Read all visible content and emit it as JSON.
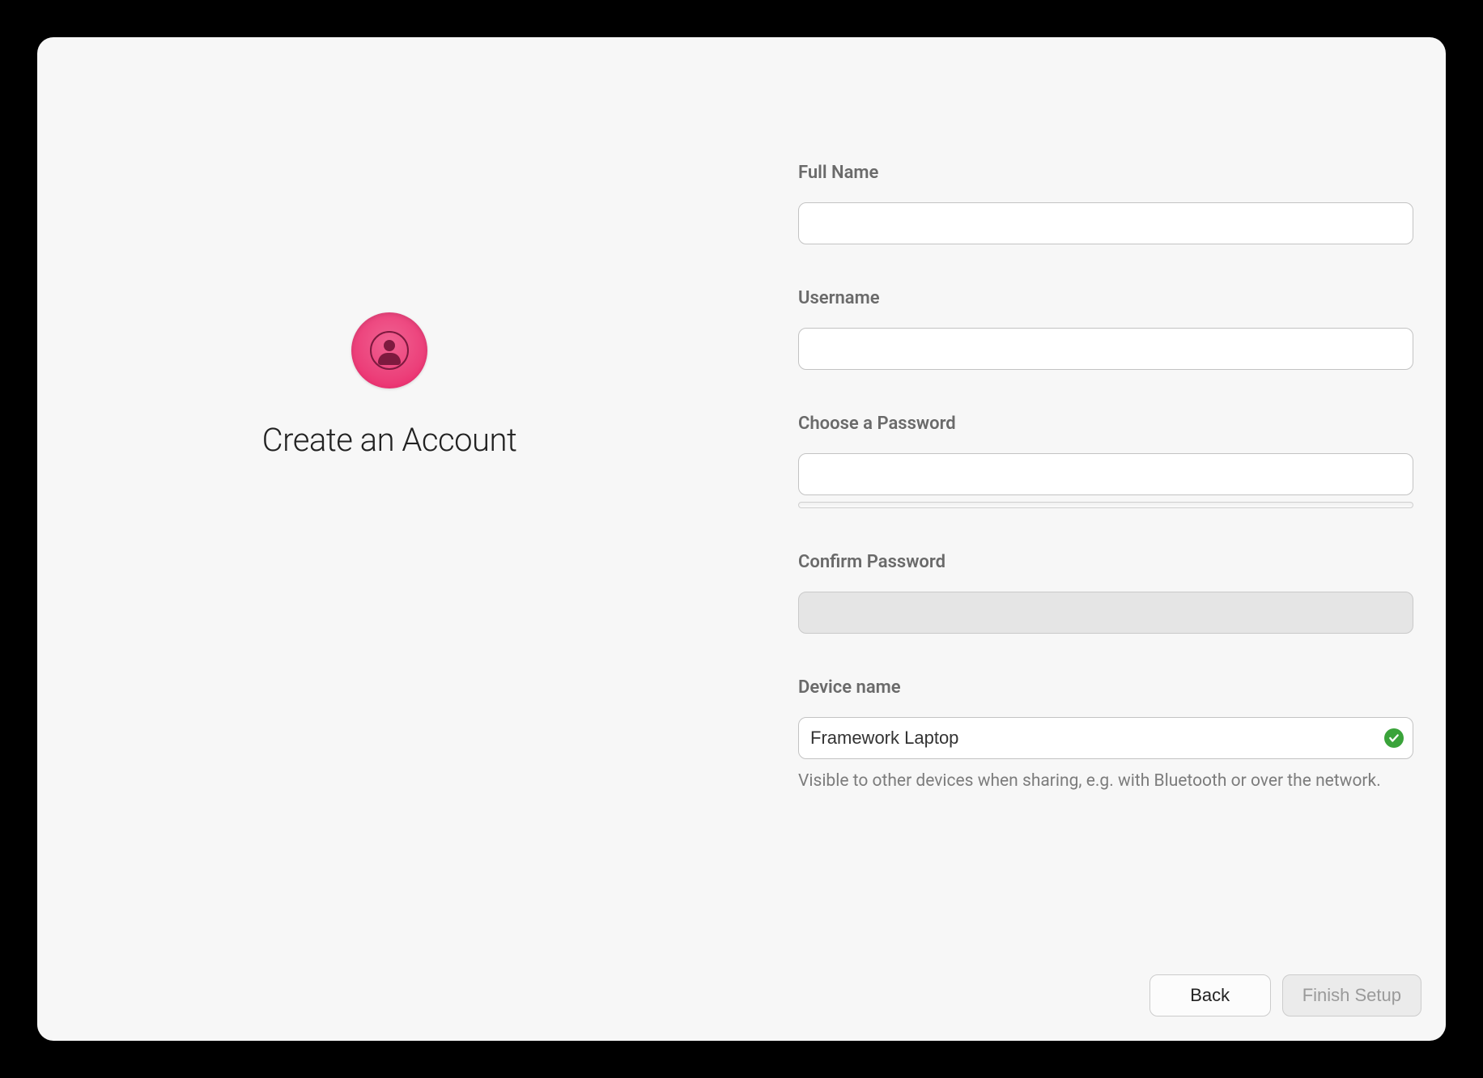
{
  "page": {
    "title": "Create an Account"
  },
  "form": {
    "full_name": {
      "label": "Full Name",
      "value": ""
    },
    "username": {
      "label": "Username",
      "value": ""
    },
    "password": {
      "label": "Choose a Password",
      "value": ""
    },
    "confirm_password": {
      "label": "Confirm Password",
      "value": ""
    },
    "device_name": {
      "label": "Device name",
      "value": "Framework Laptop",
      "valid": true,
      "help": "Visible to other devices when sharing, e.g. with Bluetooth or over the network."
    }
  },
  "buttons": {
    "back": "Back",
    "finish": "Finish Setup"
  },
  "colors": {
    "accent_pink": "#ec407a",
    "success_green": "#3aa33a"
  }
}
